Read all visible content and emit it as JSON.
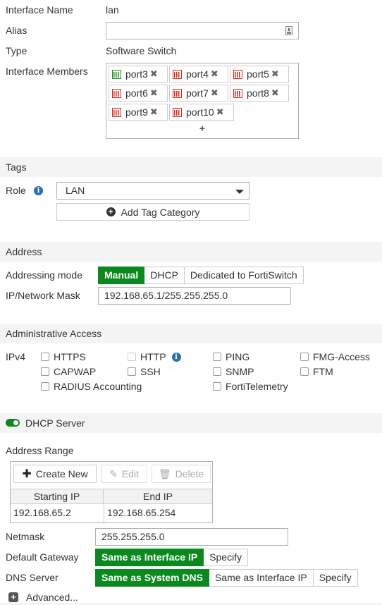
{
  "general": {
    "interface_name_label": "Interface Name",
    "interface_name_value": "lan",
    "alias_label": "Alias",
    "alias_value": "",
    "type_label": "Type",
    "type_value": "Software Switch",
    "members_label": "Interface Members",
    "members": [
      {
        "name": "port3",
        "status": "up"
      },
      {
        "name": "port4",
        "status": "down"
      },
      {
        "name": "port5",
        "status": "down"
      },
      {
        "name": "port6",
        "status": "down"
      },
      {
        "name": "port7",
        "status": "down"
      },
      {
        "name": "port8",
        "status": "down"
      },
      {
        "name": "port9",
        "status": "down"
      },
      {
        "name": "port10",
        "status": "down"
      }
    ],
    "add_member": "+"
  },
  "tags": {
    "header": "Tags",
    "role_label": "Role",
    "role_value": "LAN",
    "add_tag_category": "Add Tag Category"
  },
  "address": {
    "header": "Address",
    "mode_label": "Addressing mode",
    "modes": [
      "Manual",
      "DHCP",
      "Dedicated to FortiSwitch"
    ],
    "active_mode": "Manual",
    "ip_label": "IP/Network Mask",
    "ip_value": "192.168.65.1/255.255.255.0"
  },
  "admin_access": {
    "header": "Administrative Access",
    "ipv4_label": "IPv4",
    "options": [
      {
        "label": "HTTPS",
        "checked": false
      },
      {
        "label": "HTTP",
        "checked": false,
        "disabled": true
      },
      {
        "label": "PING",
        "checked": false
      },
      {
        "label": "FMG-Access",
        "checked": false
      },
      {
        "label": "CAPWAP",
        "checked": false
      },
      {
        "label": "SSH",
        "checked": false
      },
      {
        "label": "SNMP",
        "checked": false
      },
      {
        "label": "FTM",
        "checked": false
      },
      {
        "label": "RADIUS Accounting",
        "checked": false
      },
      {
        "label": "FortiTelemetry",
        "checked": false
      }
    ]
  },
  "dhcp": {
    "header": "DHCP Server",
    "enabled": true,
    "address_range_label": "Address Range",
    "create_new": "Create New",
    "edit": "Edit",
    "delete": "Delete",
    "columns": [
      "Starting IP",
      "End IP"
    ],
    "rows": [
      [
        "192.168.65.2",
        "192.168.65.254"
      ]
    ],
    "netmask_label": "Netmask",
    "netmask_value": "255.255.255.0",
    "gateway_label": "Default Gateway",
    "gateway_options": [
      "Same as Interface IP",
      "Specify"
    ],
    "gateway_active": "Same as Interface IP",
    "dns_label": "DNS Server",
    "dns_options": [
      "Same as System DNS",
      "Same as Interface IP",
      "Specify"
    ],
    "dns_active": "Same as System DNS",
    "advanced": "Advanced..."
  },
  "colors": {
    "accent_green": "#0a8a1e",
    "port_up": "#1a8a1a",
    "port_down": "#d9261c",
    "info_blue": "#2a6eb5",
    "section_bg": "#f4f4f4"
  }
}
